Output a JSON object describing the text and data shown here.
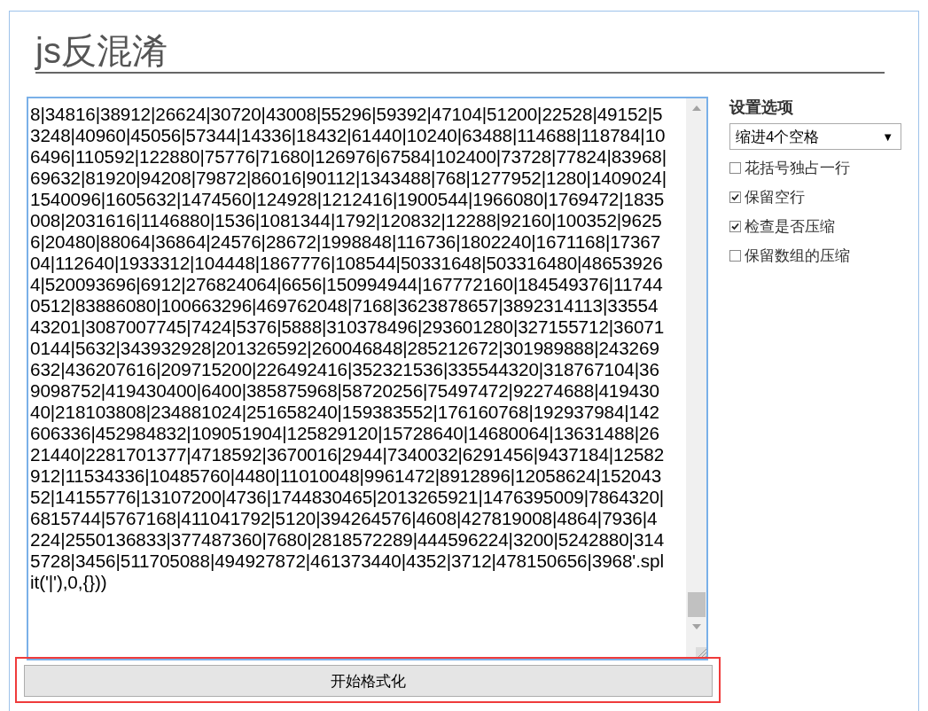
{
  "title": "js反混淆",
  "editor": {
    "lines": [
      "8|34816|38912|26624|30720|43008|55296|59392|47104|51200|22528|49152|5",
      "3248|40960|45056|57344|14336|18432|61440|10240|63488|114688|118784|10",
      "6496|110592|122880|75776|71680|126976|67584|102400|73728|77824|83968|",
      "69632|81920|94208|79872|86016|90112|1343488|768|1277952|1280|1409024|",
      "1540096|1605632|1474560|124928|1212416|1900544|1966080|1769472|1835",
      "008|2031616|1146880|1536|1081344|1792|120832|12288|92160|100352|9625",
      "6|20480|88064|36864|24576|28672|1998848|116736|1802240|1671168|17367",
      "04|112640|1933312|104448|1867776|108544|50331648|503316480|48653926",
      "4|520093696|6912|276824064|6656|150994944|167772160|184549376|11744",
      "0512|83886080|100663296|469762048|7168|3623878657|3892314113|33554",
      "43201|3087007745|7424|5376|5888|310378496|293601280|327155712|36071",
      "0144|5632|343932928|201326592|260046848|285212672|301989888|243269",
      "632|436207616|209715200|226492416|352321536|335544320|318767104|36",
      "9098752|419430400|6400|385875968|58720256|75497472|92274688|419430",
      "40|218103808|234881024|251658240|159383552|176160768|192937984|142",
      "606336|452984832|109051904|125829120|15728640|14680064|13631488|26",
      "21440|2281701377|4718592|3670016|2944|7340032|6291456|9437184|12582",
      "912|11534336|10485760|4480|11010048|9961472|8912896|12058624|152043",
      "52|14155776|13107200|4736|1744830465|2013265921|1476395009|7864320|",
      "6815744|5767168|411041792|5120|394264576|4608|427819008|4864|7936|4",
      "224|2550136833|377487360|7680|2818572289|444596224|3200|5242880|314",
      "5728|3456|511705088|494927872|461373440|4352|3712|478150656|3968'.spl",
      "it('|'),0,{}))"
    ]
  },
  "settings": {
    "heading": "设置选项",
    "indent_select": {
      "value": "缩进4个空格",
      "arrow": "▼"
    },
    "options": [
      {
        "label": "花括号独占一行",
        "checked": false
      },
      {
        "label": "保留空行",
        "checked": true
      },
      {
        "label": "检查是否压缩",
        "checked": true
      },
      {
        "label": "保留数组的压缩",
        "checked": false
      }
    ]
  },
  "format_button": {
    "label": "开始格式化",
    "highlighted": true
  }
}
